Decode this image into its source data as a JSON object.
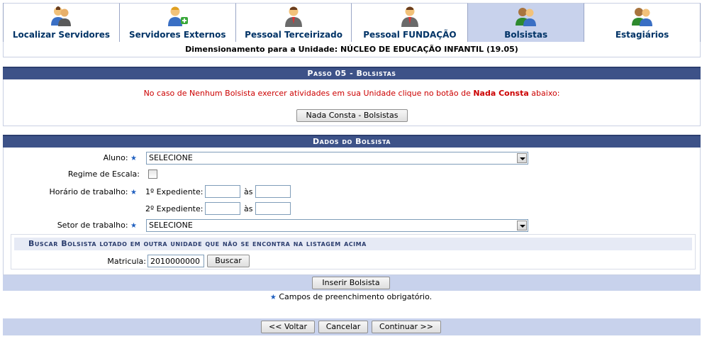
{
  "tabs": [
    {
      "label": "Localizar Servidores",
      "icon": "users-search-icon",
      "active": false
    },
    {
      "label": "Servidores Externos",
      "icon": "user-add-icon",
      "active": false
    },
    {
      "label": "Pessoal Terceirizado",
      "icon": "user-suit-icon",
      "active": false
    },
    {
      "label": "Pessoal FUNDAÇÃO",
      "icon": "user-suit-icon",
      "active": false
    },
    {
      "label": "Bolsistas",
      "icon": "users-group-icon",
      "active": true
    },
    {
      "label": "Estagiários",
      "icon": "users-group-icon",
      "active": false
    }
  ],
  "dimension_text": "Dimensionamento para a Unidade: NÚCLEO DE EDUCAÇÃO INFANTIL (19.05)",
  "step": {
    "title": "Passo 05 - Bolsistas",
    "warning_prefix": "No caso de Nenhum Bolsista exercer atividades em sua Unidade clique no botão de ",
    "warning_strong": "Nada Consta",
    "warning_suffix": " abaixo:",
    "nada_consta_button": "Nada Consta - Bolsistas"
  },
  "form": {
    "title": "Dados do Bolsista",
    "aluno_label": "Aluno:",
    "aluno_value": "SELECIONE",
    "regime_label": "Regime de Escala:",
    "horario_label": "Horário de trabalho:",
    "expediente1_label": "1º Expediente:",
    "expediente2_label": "2º Expediente:",
    "as_label": "às",
    "setor_label": "Setor de trabalho:",
    "setor_value": "SELECIONE",
    "search_title": "Buscar Bolsista lotado em outra unidade que não se encontra na listagem acima",
    "matricula_label": "Matricula:",
    "matricula_value": "2010000000",
    "buscar_button": "Buscar",
    "inserir_button": "Inserir Bolsista",
    "required_note": "Campos de preenchimento obrigatório.",
    "required_mark": "★"
  },
  "footer": {
    "voltar_button": "<< Voltar",
    "cancelar_button": "Cancelar",
    "continuar_button": "Continuar >>"
  },
  "colors": {
    "header_bg": "#3d5288",
    "active_tab_bg": "#c8d2ec",
    "warning_text": "#cc0000",
    "tab_label": "#003366"
  }
}
